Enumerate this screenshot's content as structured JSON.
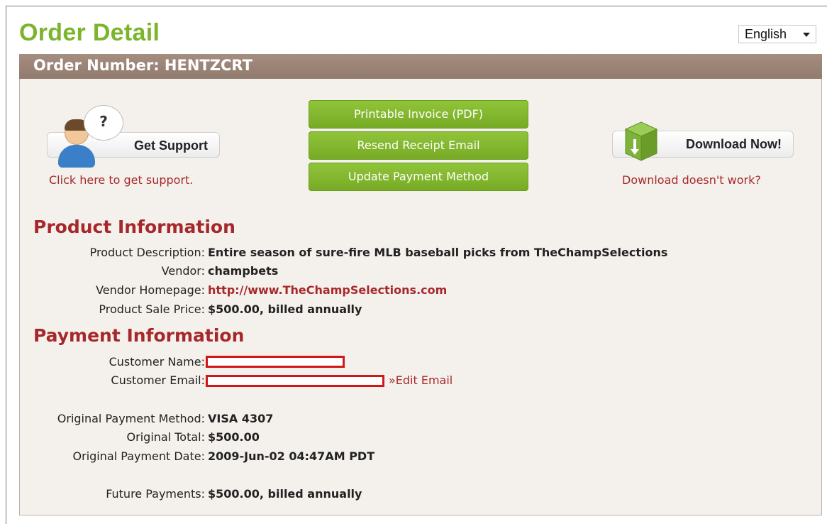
{
  "page": {
    "title": "Order Detail",
    "language": "English"
  },
  "order": {
    "number_label": "Order Number: HENTZCRT"
  },
  "support": {
    "bubble_symbol": "?",
    "button_label": "Get Support",
    "link_text": "Click here to get support."
  },
  "actions": {
    "printable_invoice": "Printable Invoice (PDF)",
    "resend_receipt": "Resend Receipt Email",
    "update_payment": "Update Payment Method"
  },
  "download": {
    "button_label": "Download Now!",
    "link_text": "Download doesn't work?"
  },
  "product": {
    "heading": "Product Information",
    "description_label": "Product Description:",
    "description": "Entire season of sure-fire MLB baseball picks from TheChampSelections",
    "vendor_label": "Vendor:",
    "vendor": "champbets",
    "homepage_label": "Vendor Homepage:",
    "homepage": "http://www.TheChampSelections.com",
    "price_label": "Product Sale Price:",
    "price": "$500.00, billed annually"
  },
  "payment": {
    "heading": "Payment Information",
    "customer_name_label": "Customer Name:",
    "customer_email_label": "Customer Email:",
    "edit_email": "»Edit Email",
    "method_label": "Original Payment Method:",
    "method": "VISA 4307",
    "total_label": "Original Total:",
    "total": "$500.00",
    "date_label": "Original Payment Date:",
    "date": "2009-Jun-02 04:47AM PDT",
    "future_label": "Future Payments:",
    "future": "$500.00, billed annually"
  },
  "colors": {
    "title_green": "#7cb42c",
    "accent_red": "#a6282b",
    "order_bar": "#9c8678",
    "panel_bg": "#f4f1ec",
    "button_green": "#84b830"
  }
}
